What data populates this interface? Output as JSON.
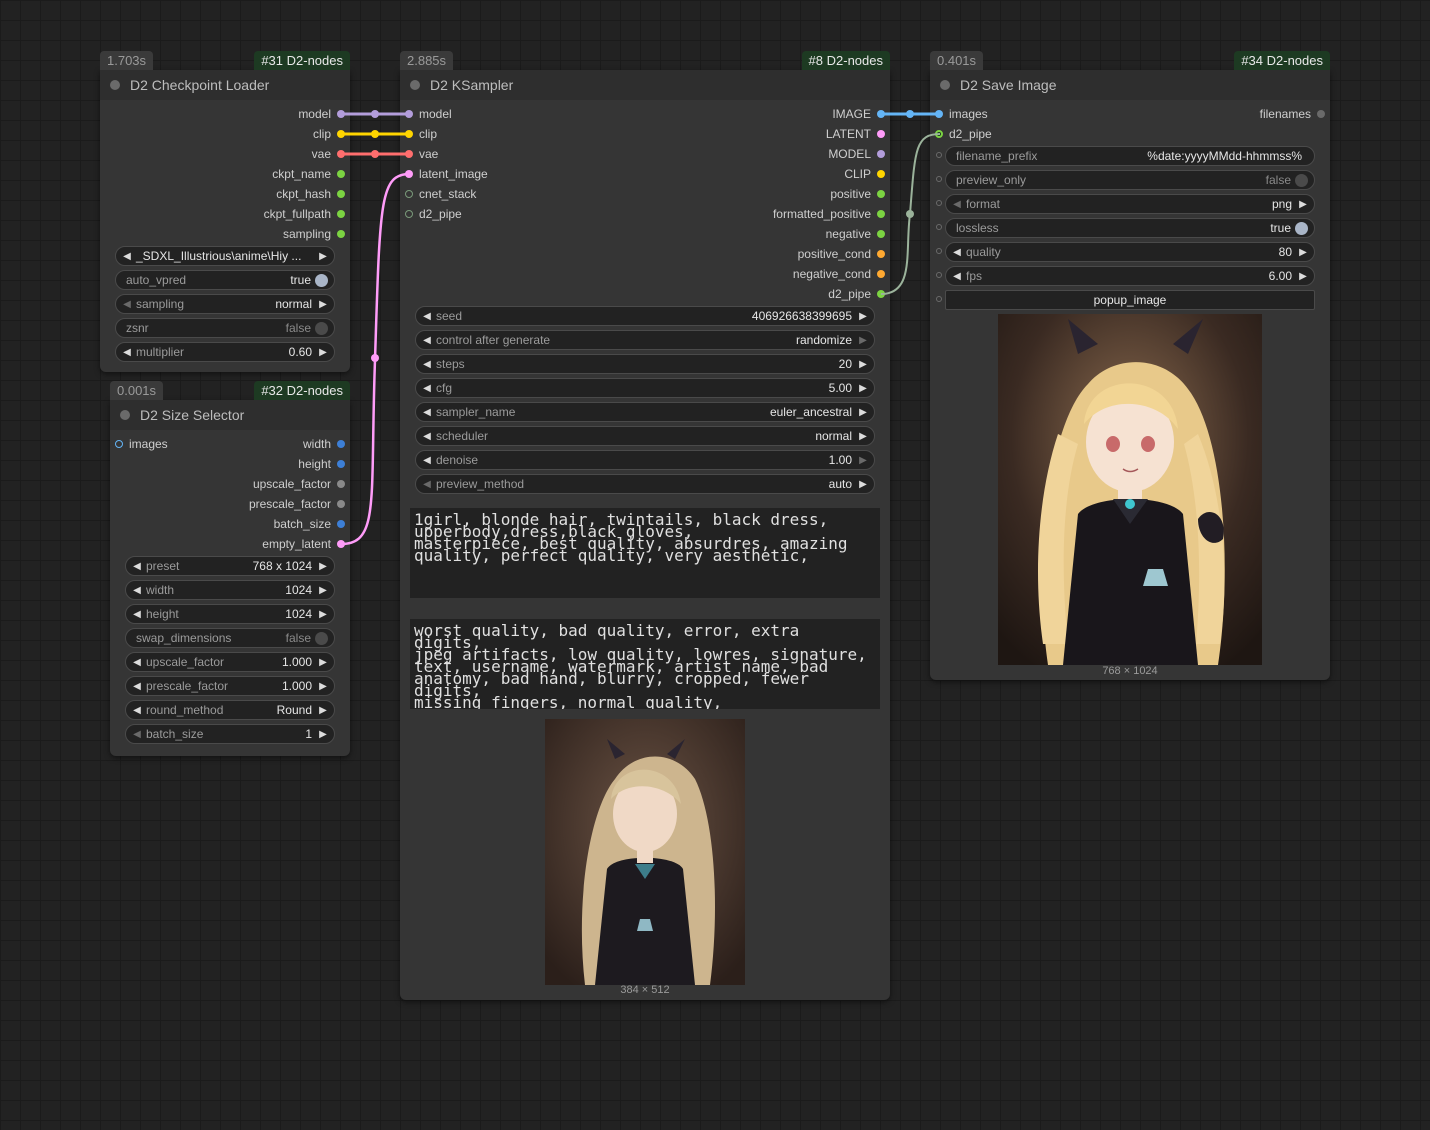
{
  "nodes": {
    "checkpoint_loader": {
      "time": "1.703s",
      "id_badge": "#31 D2-nodes",
      "title": "D2 Checkpoint Loader",
      "outputs": [
        "model",
        "clip",
        "vae",
        "ckpt_name",
        "ckpt_hash",
        "ckpt_fullpath",
        "sampling"
      ],
      "widgets": [
        {
          "label": "_SDXL_Illustrious\\anime\\Hiy ...",
          "value": ""
        },
        {
          "label": "auto_vpred",
          "value": "true"
        },
        {
          "label": "sampling",
          "value": "normal"
        },
        {
          "label": "zsnr",
          "value": "false"
        },
        {
          "label": "multiplier",
          "value": "0.60"
        }
      ]
    },
    "size_selector": {
      "time": "0.001s",
      "id_badge": "#32 D2-nodes",
      "title": "D2 Size Selector",
      "input": "images",
      "outputs": [
        "width",
        "height",
        "upscale_factor",
        "prescale_factor",
        "batch_size",
        "empty_latent"
      ],
      "widgets": [
        {
          "label": "preset",
          "value": "768 x 1024"
        },
        {
          "label": "width",
          "value": "1024"
        },
        {
          "label": "height",
          "value": "1024"
        },
        {
          "label": "swap_dimensions",
          "value": "false"
        },
        {
          "label": "upscale_factor",
          "value": "1.000"
        },
        {
          "label": "prescale_factor",
          "value": "1.000"
        },
        {
          "label": "round_method",
          "value": "Round"
        },
        {
          "label": "batch_size",
          "value": "1"
        }
      ]
    },
    "ksampler": {
      "time": "2.885s",
      "id_badge": "#8 D2-nodes",
      "title": "D2 KSampler",
      "inputs": [
        "model",
        "clip",
        "vae",
        "latent_image",
        "cnet_stack",
        "d2_pipe"
      ],
      "outputs": [
        "IMAGE",
        "LATENT",
        "MODEL",
        "CLIP",
        "positive",
        "formatted_positive",
        "negative",
        "positive_cond",
        "negative_cond",
        "d2_pipe"
      ],
      "widgets": [
        {
          "label": "seed",
          "value": "406926638399695"
        },
        {
          "label": "control after generate",
          "value": "randomize"
        },
        {
          "label": "steps",
          "value": "20"
        },
        {
          "label": "cfg",
          "value": "5.00"
        },
        {
          "label": "sampler_name",
          "value": "euler_ancestral"
        },
        {
          "label": "scheduler",
          "value": "normal"
        },
        {
          "label": "denoise",
          "value": "1.00"
        },
        {
          "label": "preview_method",
          "value": "auto"
        }
      ],
      "positive_prompt": "1girl, blonde hair, twintails, black dress,\nupperbody,dress,black gloves,\nmasterpiece, best quality, absurdres, amazing\nquality, perfect quality, very aesthetic,",
      "negative_prompt": "worst quality, bad quality, error, extra digits,\njpeg artifacts, low quality, lowres, signature,\ntext, username, watermark, artist name, bad\nanatomy, bad hand, blurry, cropped, fewer digits,\nmissing fingers, normal quality,",
      "preview_caption": "384 × 512"
    },
    "save_image": {
      "time": "0.401s",
      "id_badge": "#34 D2-nodes",
      "title": "D2 Save Image",
      "inputs": [
        "images",
        "d2_pipe"
      ],
      "output": "filenames",
      "widgets": [
        {
          "label": "filename_prefix",
          "value": "%date:yyyyMMdd-hhmmss%"
        },
        {
          "label": "preview_only",
          "value": "false"
        },
        {
          "label": "format",
          "value": "png"
        },
        {
          "label": "lossless",
          "value": "true"
        },
        {
          "label": "quality",
          "value": "80"
        },
        {
          "label": "fps",
          "value": "6.00"
        }
      ],
      "button": "popup_image",
      "preview_caption": "768 × 1024"
    }
  },
  "colors": {
    "model": "#b39ddb",
    "clip": "#ffd500",
    "vae": "#ff6e6e",
    "latent": "#ff9cf9",
    "image": "#64b5f6",
    "green": "#7cd342",
    "orange": "#ffa931",
    "pipe": "#9bb39b"
  }
}
